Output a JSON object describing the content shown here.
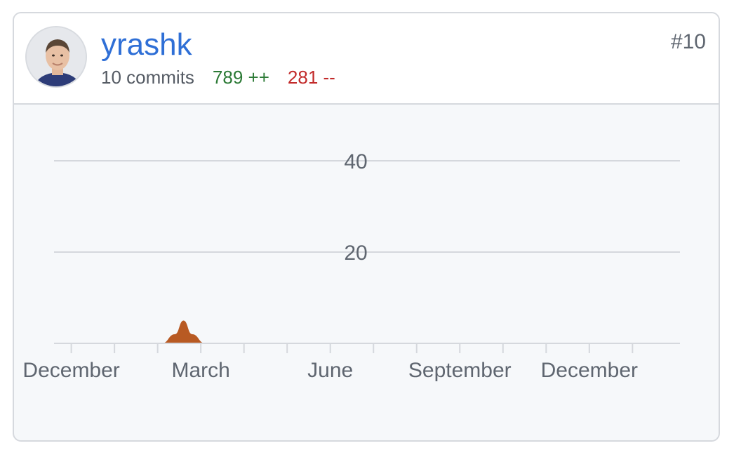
{
  "contributor": {
    "username": "yrashk",
    "commits": "10 commits",
    "additions": "789 ++",
    "deletions": "281 --",
    "rank": "#10",
    "avatar": "avatar-photo"
  },
  "colors": {
    "link": "#2f6fd6",
    "additions": "#2c7a36",
    "deletions": "#c22a2a",
    "area": "#b85a23",
    "grid": "#d5d8dd",
    "text": "#5f6670"
  },
  "chart_data": {
    "type": "area",
    "y_ticks": [
      20,
      40
    ],
    "ylim": [
      0,
      50
    ],
    "x_tick_labels": [
      "December",
      "March",
      "June",
      "September",
      "December"
    ],
    "x_months": 14.5,
    "series": [
      {
        "x": [
          2.5,
          2.8,
          3.0,
          3.2,
          3.5
        ],
        "values": [
          0,
          2,
          5,
          2,
          0
        ]
      }
    ],
    "grid": true
  }
}
